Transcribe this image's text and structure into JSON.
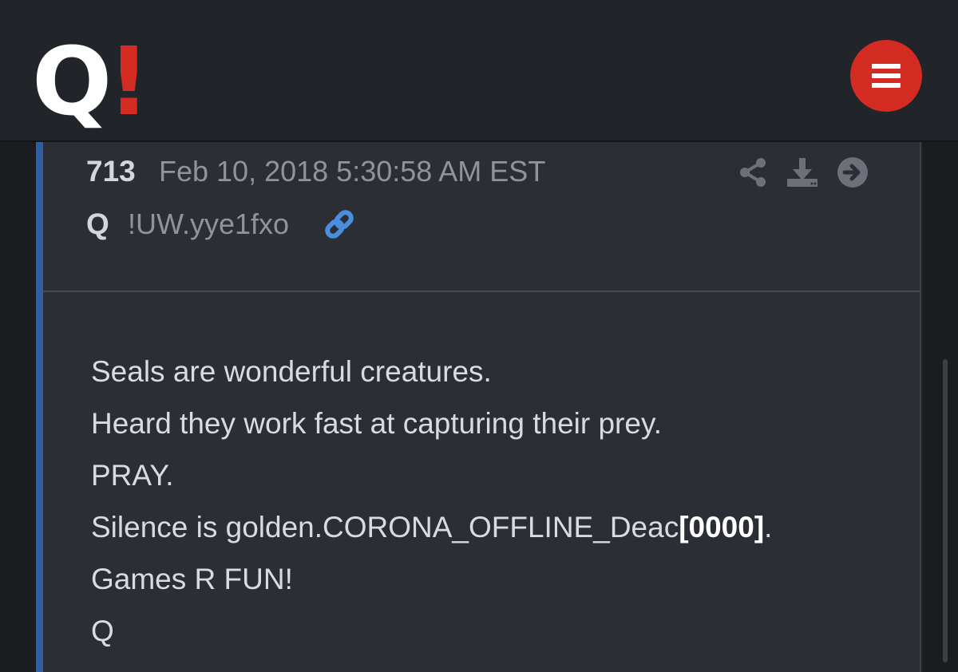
{
  "header": {
    "logo_letter": "Q",
    "logo_mark": "!",
    "menu_icon": "hamburger-menu-icon",
    "brand_colors": {
      "white": "#ffffff",
      "red": "#d42b22"
    }
  },
  "post": {
    "number": "713",
    "datetime": "Feb 10, 2018 5:30:58 AM EST",
    "author": "Q",
    "tripcode": "!UW.yye1fxo",
    "icons": [
      "link-icon",
      "share-icon",
      "download-icon",
      "arrow-right-circle-icon"
    ],
    "accent_color": "#2d5ea8",
    "body": {
      "line1": "Seals are wonderful creatures.",
      "line2": "Heard they work fast at capturing their prey.",
      "line3": "PRAY.",
      "line4_prefix": "Silence is golden.CORONA_OFFLINE_Deac",
      "line4_bold": "[0000]",
      "line4_suffix": ".",
      "line5": "Games R FUN!",
      "line6": "Q"
    }
  }
}
